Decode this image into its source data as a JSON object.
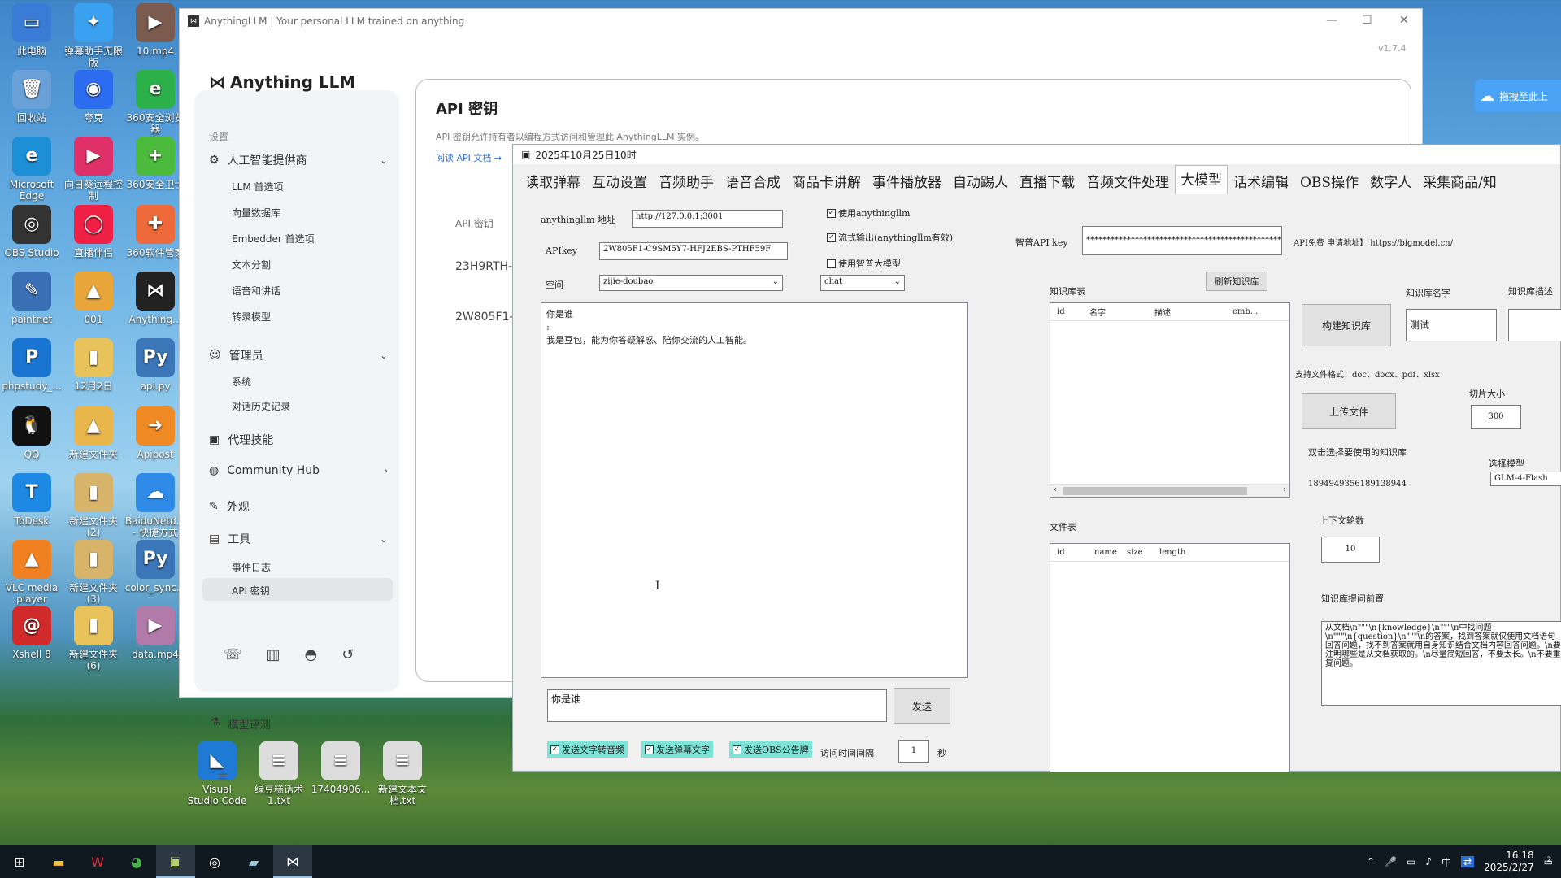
{
  "desktop": {
    "icons": [
      {
        "label": "此电脑",
        "color": "#3a7bd5",
        "glyph": "▭"
      },
      {
        "label": "弹幕助手无限\n版",
        "color": "#3aa0f0",
        "glyph": "✦"
      },
      {
        "label": "10.mp4",
        "color": "#7a5b4d",
        "glyph": "▶"
      },
      {
        "label": "回收站",
        "color": "#6aa0d8",
        "glyph": "🗑"
      },
      {
        "label": "夸克",
        "color": "#2b6cf0",
        "glyph": "◉"
      },
      {
        "label": "360安全浏览\n器",
        "color": "#2bb04a",
        "glyph": "e"
      },
      {
        "label": "Microsoft\nEdge",
        "color": "#1d8fd6",
        "glyph": "e"
      },
      {
        "label": "向日葵远程控\n制",
        "color": "#e0306a",
        "glyph": "▶"
      },
      {
        "label": "360安全卫士",
        "color": "#4cba3c",
        "glyph": "+"
      },
      {
        "label": "OBS Studio",
        "color": "#333",
        "glyph": "◎"
      },
      {
        "label": "直播伴侣",
        "color": "#f02045",
        "glyph": "◯"
      },
      {
        "label": "360软件管家",
        "color": "#ee6a3a",
        "glyph": "✚"
      },
      {
        "label": "paintnet",
        "color": "#3b6fb5",
        "glyph": "✎"
      },
      {
        "label": "001",
        "color": "#e8a53a",
        "glyph": "▲"
      },
      {
        "label": "Anything...",
        "color": "#222",
        "glyph": "⋈"
      },
      {
        "label": "phpstudy_...",
        "color": "#1a75d2",
        "glyph": "P"
      },
      {
        "label": "12月2日",
        "color": "#e8c25a",
        "glyph": "▮"
      },
      {
        "label": "api.py",
        "color": "#3b76b8",
        "glyph": "Py"
      },
      {
        "label": "QQ",
        "color": "#111",
        "glyph": "🐧"
      },
      {
        "label": "新建文件夹",
        "color": "#e8b64a",
        "glyph": "▲"
      },
      {
        "label": "Apipost",
        "color": "#f08a24",
        "glyph": "➜"
      },
      {
        "label": "ToDesk",
        "color": "#1e88e5",
        "glyph": "T"
      },
      {
        "label": "新建文件夹\n(2)",
        "color": "#d8b36a",
        "glyph": "▮"
      },
      {
        "label": "BaiduNetd...\n- 快捷方式",
        "color": "#2f8ae8",
        "glyph": "☁"
      },
      {
        "label": "VLC media\nplayer",
        "color": "#f08020",
        "glyph": "▲"
      },
      {
        "label": "新建文件夹\n(3)",
        "color": "#d8b36a",
        "glyph": "▮"
      },
      {
        "label": "color_sync...",
        "color": "#3b76b8",
        "glyph": "Py"
      },
      {
        "label": "Xshell 8",
        "color": "#d02a2a",
        "glyph": "@"
      },
      {
        "label": "新建文件夹\n(6)",
        "color": "#e8c25a",
        "glyph": "▮"
      },
      {
        "label": "data.mp4",
        "color": "#b27aa8",
        "glyph": "▶"
      },
      {
        "label": "Visual\nStudio Code",
        "color": "#1f7ad6",
        "glyph": "◣"
      },
      {
        "label": "绿豆糕话术\n1.txt",
        "color": "#ddd",
        "glyph": "≡"
      },
      {
        "label": "17404906...",
        "color": "#ddd",
        "glyph": "≡"
      },
      {
        "label": "新建文本文\n档.txt",
        "color": "#ddd",
        "glyph": "≡"
      }
    ]
  },
  "allm": {
    "title": "AnythingLLM | Your personal LLM trained on anything",
    "version": "v1.7.4",
    "logo": "Anything LLM",
    "settings_label": "设置",
    "ai_provider": "人工智能提供商",
    "llm_pref": "LLM 首选项",
    "vector_db": "向量数据库",
    "embedder": "Embedder 首选项",
    "text_split": "文本分割",
    "voice": "语音和讲话",
    "transcribe": "转录模型",
    "admin": "管理员",
    "system": "系统",
    "history": "对话历史记录",
    "agent": "代理技能",
    "community": "Community Hub",
    "appearance": "外观",
    "tools": "工具",
    "events": "事件日志",
    "api_keys": "API 密钥",
    "model_eval": "模型评测",
    "page_title": "API 密钥",
    "page_desc": "API 密钥允许持有者以编程方式访问和管理此 AnythingLLM 实例。",
    "read_docs": "阅读 API 文档 →",
    "col_key": "API 密钥",
    "key1": "23H9RTH-F",
    "key2": "2W805F1-"
  },
  "baidu_btn": "拖拽至此上",
  "tool": {
    "title": "2025年10月25日10时",
    "tabs": [
      "读取弹幕",
      "互动设置",
      "音频助手",
      "语音合成",
      "商品卡讲解",
      "事件播放器",
      "自动踢人",
      "直播下载",
      "音频文件处理",
      "大模型",
      "话术编辑",
      "OBS操作",
      "数字人",
      "采集商品/知"
    ],
    "active_tab": "大模型",
    "addr_label": "anythingllm 地址",
    "addr_value": "http://127.0.0.1:3001",
    "apikey_label": "APIkey",
    "apikey_value": "2W805F1-C9SM5Y7-HFJ2EBS-PTHF59F",
    "space_label": "空间",
    "space_value": "zijie-doubao",
    "mode_value": "chat",
    "chk_use_allm": "使用anythingllm",
    "chk_stream": "流式输出(anythingllm有效)",
    "chk_zhipu": "使用智普大模型",
    "zhipu_key_label": "智普API key",
    "zhipu_key_value": "************************************************",
    "api_free": "API免费 申请地址】 https://bigmodel.cn/",
    "chat_q": "你是谁",
    "chat_colon": ":",
    "chat_a": "我是豆包，能为你答疑解惑、陪你交流的人工智能。",
    "input_value": "你是谁",
    "send": "发送",
    "opt1": "发送文字转音频",
    "opt2": "发送弹幕文字",
    "opt3": "发送OBS公告牌",
    "interval_label": "访问时间间隔",
    "interval_value": "1",
    "interval_unit": "秒",
    "kb_list_label": "知识库表",
    "refresh_kb": "刷新知识库",
    "kb_cols": [
      "id",
      "名字",
      "描述",
      "emb..."
    ],
    "build_kb": "构建知识库",
    "kb_name_label": "知识库名字",
    "kb_name_value": "测试",
    "kb_desc_label": "知识库描述",
    "formats": "支持文件格式：doc、docx、pdf、xlsx",
    "upload": "上传文件",
    "chunk_label": "切片大小",
    "chunk_value": "300",
    "dbl_hint": "双击选择要使用的知识库",
    "kb_id": "1894949356189138944",
    "model_label": "选择模型",
    "model_value": "GLM-4-Flash",
    "file_list_label": "文件表",
    "file_cols": [
      "id",
      "name",
      "size",
      "length"
    ],
    "ctx_label": "上下文轮数",
    "ctx_value": "10",
    "prompt_label": "知识库提问前置",
    "prompt_value": "从文档\\n\"\"\"\\n{knowledge}\\n\"\"\"\\n中找问题\\n\"\"\"\\n{question}\\n\"\"\"\\n的答案，找到答案就仅使用文档语句回答问题，找不到答案就用自身知识结合文档内容回答问题。\\n要注明哪些是从文档获取的。\\n尽量简短回答，不要太长。\\n不要重复问题。"
  },
  "taskbar": {
    "time": "16:18",
    "date": "2025/2/27",
    "ime": "中",
    "notif": "2"
  }
}
